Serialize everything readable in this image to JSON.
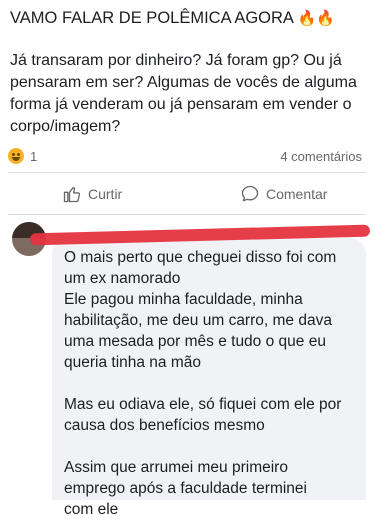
{
  "post": {
    "title": "VAMO FALAR DE POLÊMICA AGORA",
    "title_emoji": "🔥🔥",
    "body": "Já transaram por dinheiro? Já foram gp? Ou já\npensaram em ser? Algumas de vocês de alguma\nforma já venderam ou já pensaram em vender o\ncorpo/imagem?"
  },
  "stats": {
    "reaction_icon": "laughing-emoji-icon",
    "reaction_count": "1",
    "comments_count": "4 comentários"
  },
  "actions": {
    "like_label": "Curtir",
    "like_icon": "thumbs-up-icon",
    "comment_label": "Comentar",
    "comment_icon": "speech-bubble-icon"
  },
  "comment": {
    "author_name": "",
    "text": "O mais perto que cheguei disso foi com\num ex namorado\nEle pagou minha faculdade, minha\nhabilitação, me deu um carro, me dava\numa mesada por mês e tudo o que eu\nqueria tinha na mão\n\nMas eu odiava ele, só fiquei com ele por\ncausa dos benefícios mesmo\n\nAssim que arrumei meu primeiro\nemprego após a faculdade terminei\ncom ele"
  },
  "colors": {
    "text_primary": "#1c1e21",
    "text_secondary": "#65676b",
    "bubble_bg": "#f0f2f5",
    "redaction": "#e5343f"
  }
}
